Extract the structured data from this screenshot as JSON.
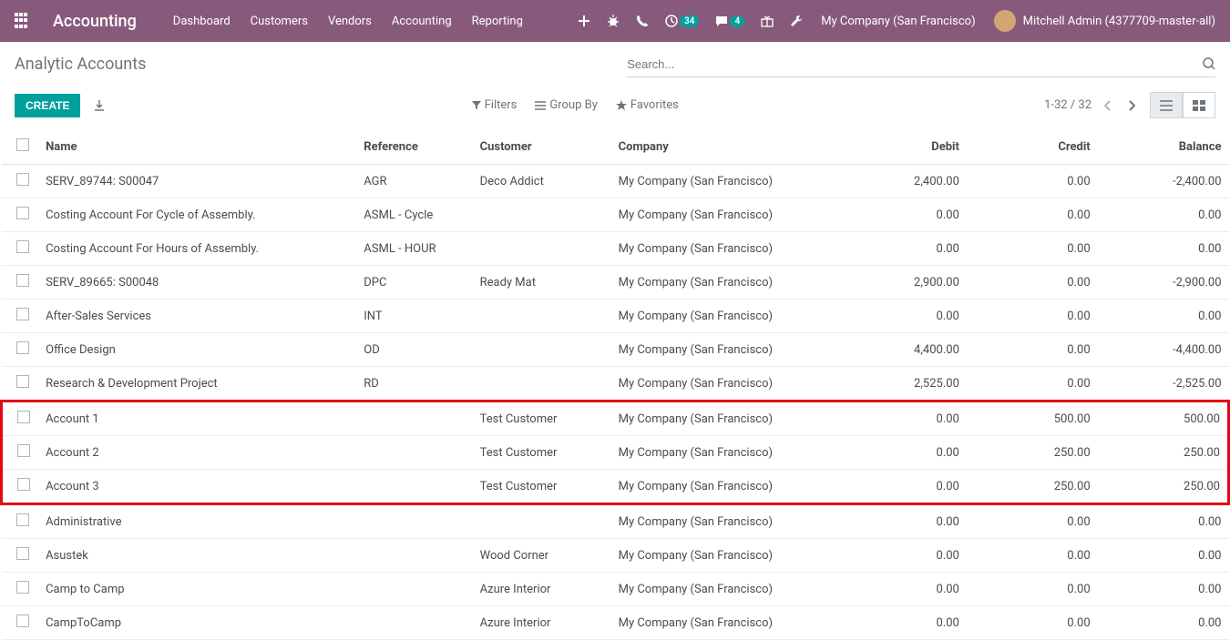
{
  "topnav": {
    "brand": "Accounting",
    "menu": [
      "Dashboard",
      "Customers",
      "Vendors",
      "Accounting",
      "Reporting"
    ],
    "clock_badge": "34",
    "chat_badge": "4",
    "company": "My Company (San Francisco)",
    "user": "Mitchell Admin (4377709-master-all)"
  },
  "breadcrumb": "Analytic Accounts",
  "search_placeholder": "Search...",
  "buttons": {
    "create": "CREATE",
    "filters": "Filters",
    "groupby": "Group By",
    "favorites": "Favorites"
  },
  "pager": "1-32 / 32",
  "columns": {
    "name": "Name",
    "reference": "Reference",
    "customer": "Customer",
    "company": "Company",
    "debit": "Debit",
    "credit": "Credit",
    "balance": "Balance"
  },
  "rows": [
    {
      "name": "SERV_89744: S00047",
      "reference": "AGR",
      "customer": "Deco Addict",
      "company": "My Company (San Francisco)",
      "debit": "2,400.00",
      "credit": "0.00",
      "balance": "-2,400.00"
    },
    {
      "name": "Costing Account For Cycle of Assembly.",
      "reference": "ASML - Cycle",
      "customer": "",
      "company": "My Company (San Francisco)",
      "debit": "0.00",
      "credit": "0.00",
      "balance": "0.00"
    },
    {
      "name": "Costing Account For Hours of Assembly.",
      "reference": "ASML - HOUR",
      "customer": "",
      "company": "My Company (San Francisco)",
      "debit": "0.00",
      "credit": "0.00",
      "balance": "0.00"
    },
    {
      "name": "SERV_89665: S00048",
      "reference": "DPC",
      "customer": "Ready Mat",
      "company": "My Company (San Francisco)",
      "debit": "2,900.00",
      "credit": "0.00",
      "balance": "-2,900.00"
    },
    {
      "name": "After-Sales Services",
      "reference": "INT",
      "customer": "",
      "company": "My Company (San Francisco)",
      "debit": "0.00",
      "credit": "0.00",
      "balance": "0.00"
    },
    {
      "name": "Office Design",
      "reference": "OD",
      "customer": "",
      "company": "My Company (San Francisco)",
      "debit": "4,400.00",
      "credit": "0.00",
      "balance": "-4,400.00"
    },
    {
      "name": "Research & Development Project",
      "reference": "RD",
      "customer": "",
      "company": "My Company (San Francisco)",
      "debit": "2,525.00",
      "credit": "0.00",
      "balance": "-2,525.00"
    },
    {
      "name": "Account 1",
      "reference": "",
      "customer": "Test Customer",
      "company": "My Company (San Francisco)",
      "debit": "0.00",
      "credit": "500.00",
      "balance": "500.00",
      "hl": true
    },
    {
      "name": "Account 2",
      "reference": "",
      "customer": "Test Customer",
      "company": "My Company (San Francisco)",
      "debit": "0.00",
      "credit": "250.00",
      "balance": "250.00",
      "hl": true
    },
    {
      "name": "Account 3",
      "reference": "",
      "customer": "Test Customer",
      "company": "My Company (San Francisco)",
      "debit": "0.00",
      "credit": "250.00",
      "balance": "250.00",
      "hl": true
    },
    {
      "name": "Administrative",
      "reference": "",
      "customer": "",
      "company": "My Company (San Francisco)",
      "debit": "0.00",
      "credit": "0.00",
      "balance": "0.00"
    },
    {
      "name": "Asustek",
      "reference": "",
      "customer": "Wood Corner",
      "company": "My Company (San Francisco)",
      "debit": "0.00",
      "credit": "0.00",
      "balance": "0.00"
    },
    {
      "name": "Camp to Camp",
      "reference": "",
      "customer": "Azure Interior",
      "company": "My Company (San Francisco)",
      "debit": "0.00",
      "credit": "0.00",
      "balance": "0.00"
    },
    {
      "name": "CampToCamp",
      "reference": "",
      "customer": "Azure Interior",
      "company": "My Company (San Francisco)",
      "debit": "0.00",
      "credit": "0.00",
      "balance": "0.00"
    }
  ]
}
